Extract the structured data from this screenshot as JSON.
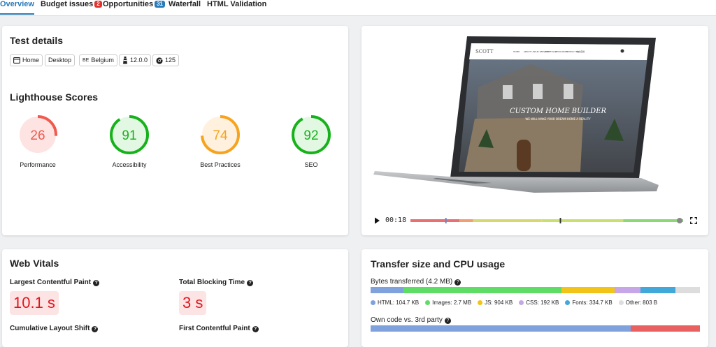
{
  "tabs": {
    "overview": "Overview",
    "budget": "Budget issues",
    "budget_count": "2",
    "opportunities": "Opportunities",
    "opportunities_count": "31",
    "waterfall": "Waterfall",
    "html_validation": "HTML Validation"
  },
  "test_details": {
    "title": "Test details",
    "chips": {
      "page": "Home",
      "device": "Desktop",
      "country_code": "BE",
      "country": "Belgium",
      "version": "12.0.0",
      "browser_version": "125"
    }
  },
  "lighthouse": {
    "title": "Lighthouse Scores",
    "scores": [
      {
        "value": "26",
        "label": "Performance",
        "fraction": 0.26,
        "color": "#f05a4f",
        "bg": "#fde3e1"
      },
      {
        "value": "91",
        "label": "Accessibility",
        "fraction": 0.91,
        "color": "#17b21b",
        "bg": "#e3f8e3"
      },
      {
        "value": "74",
        "label": "Best Practices",
        "fraction": 0.74,
        "color": "#f6a31e",
        "bg": "#fff1dd"
      },
      {
        "value": "92",
        "label": "SEO",
        "fraction": 0.92,
        "color": "#17b21b",
        "bg": "#e3f8e3"
      }
    ]
  },
  "video": {
    "time": "00:18",
    "site_headline": "CUSTOM HOME BUILDER",
    "site_tagline": "WE WILL MAKE YOUR DREAM HOME A REALITY",
    "site_logo": "SCOTT",
    "site_nav": [
      "HOME",
      "ABOUT US",
      "OUR SERVICES",
      "PORTFOLIO",
      "RESOURCES",
      "CONTACT US",
      "中文名稱"
    ],
    "progress_fraction": 0.13,
    "marker_fraction": 0.55
  },
  "web_vitals": {
    "title": "Web Vitals",
    "lcp_label": "Largest Contentful Paint",
    "lcp_value": "10.1 s",
    "tbt_label": "Total Blocking Time",
    "tbt_value": "3 s",
    "cls_label": "Cumulative Layout Shift",
    "fcp_label": "First Contentful Paint"
  },
  "transfer": {
    "title": "Transfer size and CPU usage",
    "bytes_label": "Bytes transferred (4.2 MB)",
    "segments": [
      {
        "label": "HTML: 104.7 KB",
        "color": "#7fa2dd",
        "fraction": 0.1
      },
      {
        "label": "Images: 2.7 MB",
        "color": "#5fdc65",
        "fraction": 0.48
      },
      {
        "label": "JS: 904 KB",
        "color": "#f2c318",
        "fraction": 0.16
      },
      {
        "label": "CSS: 192 KB",
        "color": "#c6a6e6",
        "fraction": 0.08
      },
      {
        "label": "Fonts: 334.7 KB",
        "color": "#42a7d9",
        "fraction": 0.105
      },
      {
        "label": "Other: 803 B",
        "color": "#dddddd",
        "fraction": 0.075
      }
    ],
    "own_code_label": "Own code vs. 3rd party",
    "own_segments": [
      {
        "color": "#7fa2dd",
        "fraction": 0.79
      },
      {
        "color": "#e86060",
        "fraction": 0.21
      }
    ]
  }
}
